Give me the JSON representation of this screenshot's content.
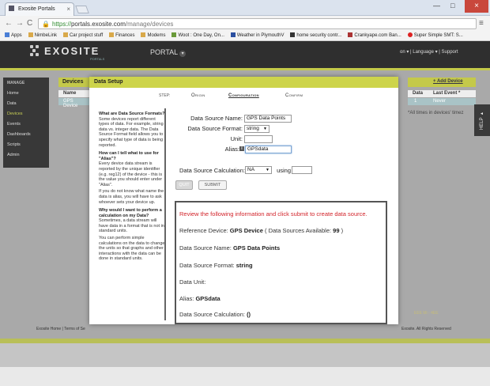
{
  "browser": {
    "tab_title": "Exosite Portals",
    "tab_close": "×",
    "url_https": "https://",
    "url_host": "portals.exosite.com",
    "url_path": "/manage/devices",
    "back": "←",
    "forward": "→",
    "reload": "C",
    "menu": "≡",
    "minimize": "—",
    "maximize": "□",
    "close": "×",
    "bookmarks": [
      "Apps",
      "NimbeLink",
      "Car project stuff",
      "Finances",
      "Modems",
      "Woot : One Day, On...",
      "Weather in PlymouthV",
      "home security contr...",
      "Crankyape.com Ban...",
      "Super Simple SMT: S..."
    ]
  },
  "site": {
    "logo_word": "EXOSITE",
    "logo_sub": "PORTALS",
    "portal_menu": "PORTAL",
    "portal_menu_chevron": "▾",
    "header_right": "on ▾ | Language ▾ | Support",
    "sidebar_title": "MANAGE",
    "sidebar_items": [
      "Home",
      "Data",
      "Devices",
      "Events",
      "Dashboards",
      "Scripts",
      "Admin"
    ],
    "devices_header": "Devices",
    "devices_col_name": "Name",
    "devices_row_name": "GPS Device",
    "add_device": "+ Add Device",
    "right_cols": {
      "data": "Data",
      "last_event": "Last Event *"
    },
    "right_row": {
      "data": "1",
      "last_event": "Never"
    },
    "times_note": "*All times in devices' timez",
    "help_tab": "HELP ▸",
    "footer_left": "Exosite Home | Terms of Se",
    "footer_right": "Exosite. All Rights Reserved",
    "faint_link": "EEE Mi - 4EE"
  },
  "modal": {
    "title": "Data Setup",
    "step_label": "STEP:",
    "steps": [
      "Origin",
      "Configuration",
      "Confirm"
    ],
    "help": [
      {
        "q": "What are Data Source Formats?",
        "a": "Some devices report different types of data. For example, string data vs. integer data. The Data Source Format field allows you to specify what type of data is being reported."
      },
      {
        "q": "How can I tell what to use for \"Alias\"?",
        "a": "Every device data stream is reported by the unique identifier (e.g. reg12) of the device - this is the value you should enter under \"Alias\".",
        "a2": "If you do not know what name the data is alias, you will have to ask whoever sets your device up."
      },
      {
        "q": "Why would I want to perform a calculation on my Data?",
        "a": "Sometimes, a data stream will have data in a format that is not in standard units.",
        "a2": "You can perform simple calculations on the data to change the units so that graphs and other interactions with the data can be done in standard units."
      }
    ],
    "form": {
      "name_label": "Data Source Name:",
      "name_value": "GPS Data Points",
      "format_label": "Data Source Format:",
      "format_value": "string",
      "unit_label": "Unit:",
      "unit_value": "",
      "alias_label": "Alias:",
      "alias_value": "GPSdata",
      "calc_label": "Data Source Calculation:",
      "calc_value": "NA",
      "using_label": "using",
      "using_value": "",
      "quit": "QUIT",
      "submit": "SUBMIT"
    },
    "review": {
      "intro": "Review the following information and click submit to create data source.",
      "device_label": "Reference Device:",
      "device_value": "GPS Device",
      "available_text": "( Data Sources Available:",
      "available_count": "99",
      "available_close": ")",
      "name_label": "Data Source Name:",
      "name_value": "GPS Data Points",
      "format_label": "Data Source Format:",
      "format_value": "string",
      "unit_label": "Data Unit:",
      "alias_label": "Alias:",
      "alias_value": "GPSdata",
      "calc_label": "Data Source Calculation:",
      "calc_value": "()"
    }
  }
}
